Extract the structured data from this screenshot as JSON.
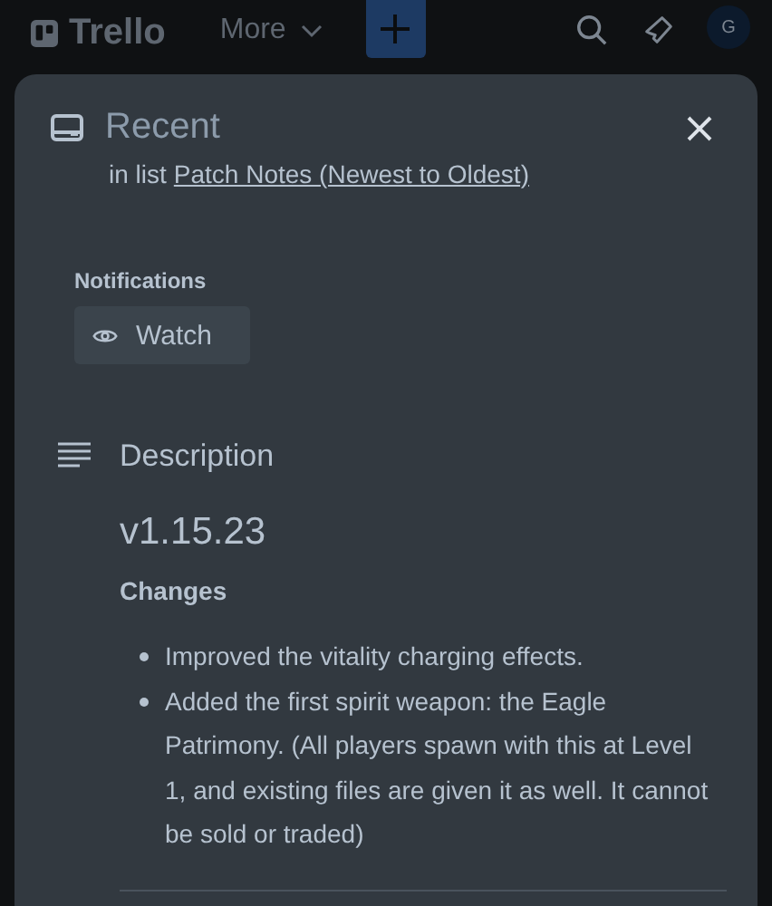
{
  "header": {
    "logo": "Trello",
    "menu": "More",
    "avatar": "G"
  },
  "card": {
    "title": "Recent",
    "list_prefix": "in list",
    "list_link": "Patch Notes (Newest to Oldest)",
    "notifications_label": "Notifications",
    "watch_button": "Watch",
    "description_heading": "Description",
    "version": "v1.15.23",
    "changes_heading": "Changes",
    "changes": [
      "Improved the vitality charging effects.",
      "Added the first spirit weapon: the Eagle Patrimony. (All players spawn with this at Level 1, and existing files are given it as well. It cannot be sold or traded)"
    ]
  }
}
